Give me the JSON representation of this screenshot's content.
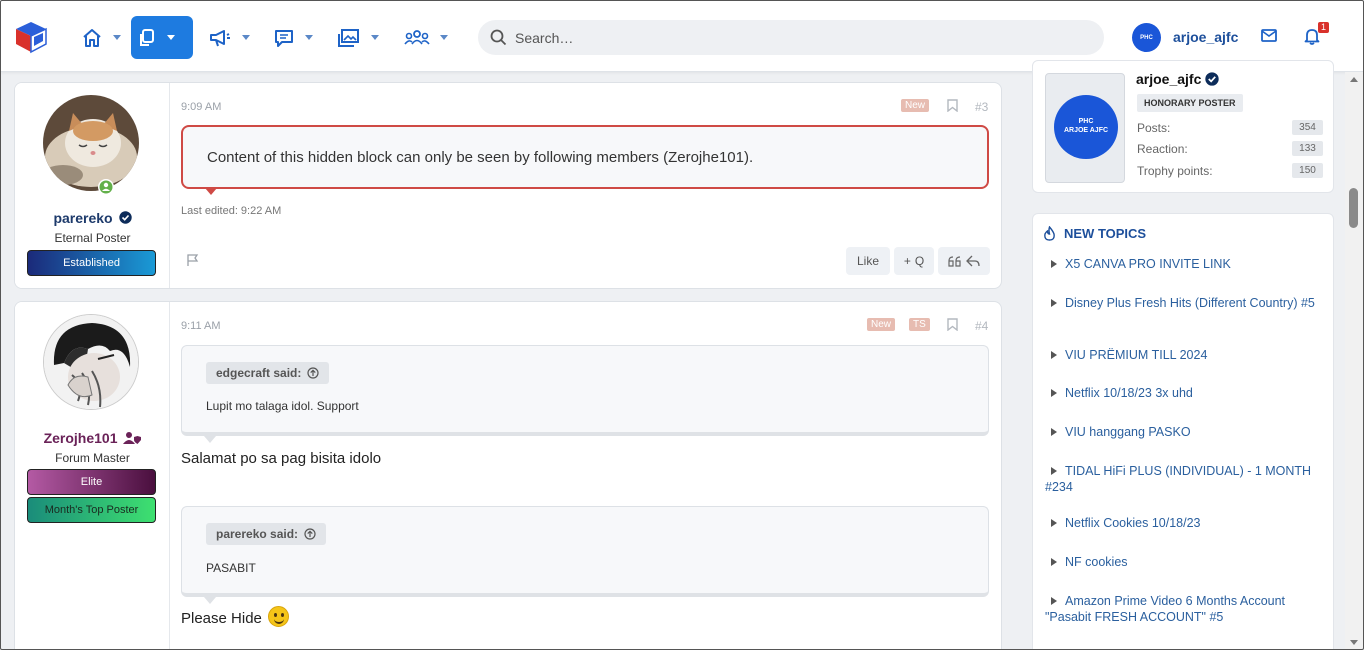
{
  "nav": {
    "search_placeholder": "Search…",
    "user_name": "arjoe_ajfc",
    "notif_count": "1",
    "avatar_text": "PHC",
    "icons": [
      "home-icon",
      "pages-icon",
      "megaphone-icon",
      "chat-icon",
      "media-icon",
      "members-icon"
    ]
  },
  "posts": [
    {
      "author": "parereko",
      "author_title": "Eternal Poster",
      "banner": "Established",
      "time": "9:09 AM",
      "tag_new": "New",
      "number": "#3",
      "hidden_text": "Content of this hidden block can only be seen by following members (Zerojhe101).",
      "edited": "Last edited: 9:22 AM",
      "like_label": "Like",
      "quote_label": "Q"
    },
    {
      "author": "Zerojhe101",
      "author_title": "Forum Master",
      "banner1": "Elite",
      "banner2": "Month's Top Poster",
      "time": "9:11 AM",
      "tag_new": "New",
      "tag_ts": "TS",
      "number": "#4",
      "quote1_author": "edgecraft said:",
      "quote1_text": "Lupit mo talaga idol. Support",
      "msg1": "Salamat po sa pag bisita idolo",
      "quote2_author": "parereko said:",
      "quote2_text": "PASABIT",
      "msg2": "Please Hide"
    }
  ],
  "profile": {
    "name": "arjoe_ajfc",
    "role": "HONORARY POSTER",
    "avatar_text_1": "PHC",
    "avatar_text_2": "ARJOE AJFC",
    "stats": [
      {
        "label": "Posts:",
        "value": "354"
      },
      {
        "label": "Reaction:",
        "value": "133"
      },
      {
        "label": "Trophy points:",
        "value": "150"
      }
    ]
  },
  "new_topics": {
    "title": "NEW TOPICS",
    "items": [
      "X5 CANVA PRO INVITE LINK",
      "Disney Plus Fresh Hits (Different Country) #5",
      "VIU PRËMIUM TILL 2024",
      "Netflix 10/18/23 3x uhd",
      "VIU hanggang PASKO",
      "TIDAL HiFi PLUS (INDIVIDUAL) - 1 MONTH #234",
      "Netflix Cookies 10/18/23",
      "NF cookies",
      "Amazon Prime Video 6 Months Account \"Pasabit FRESH ACCOUNT\" #5"
    ]
  },
  "colors": {
    "accent": "#1e7be0",
    "link": "#2a5f9e",
    "hidden_border": "#cf4a45"
  }
}
